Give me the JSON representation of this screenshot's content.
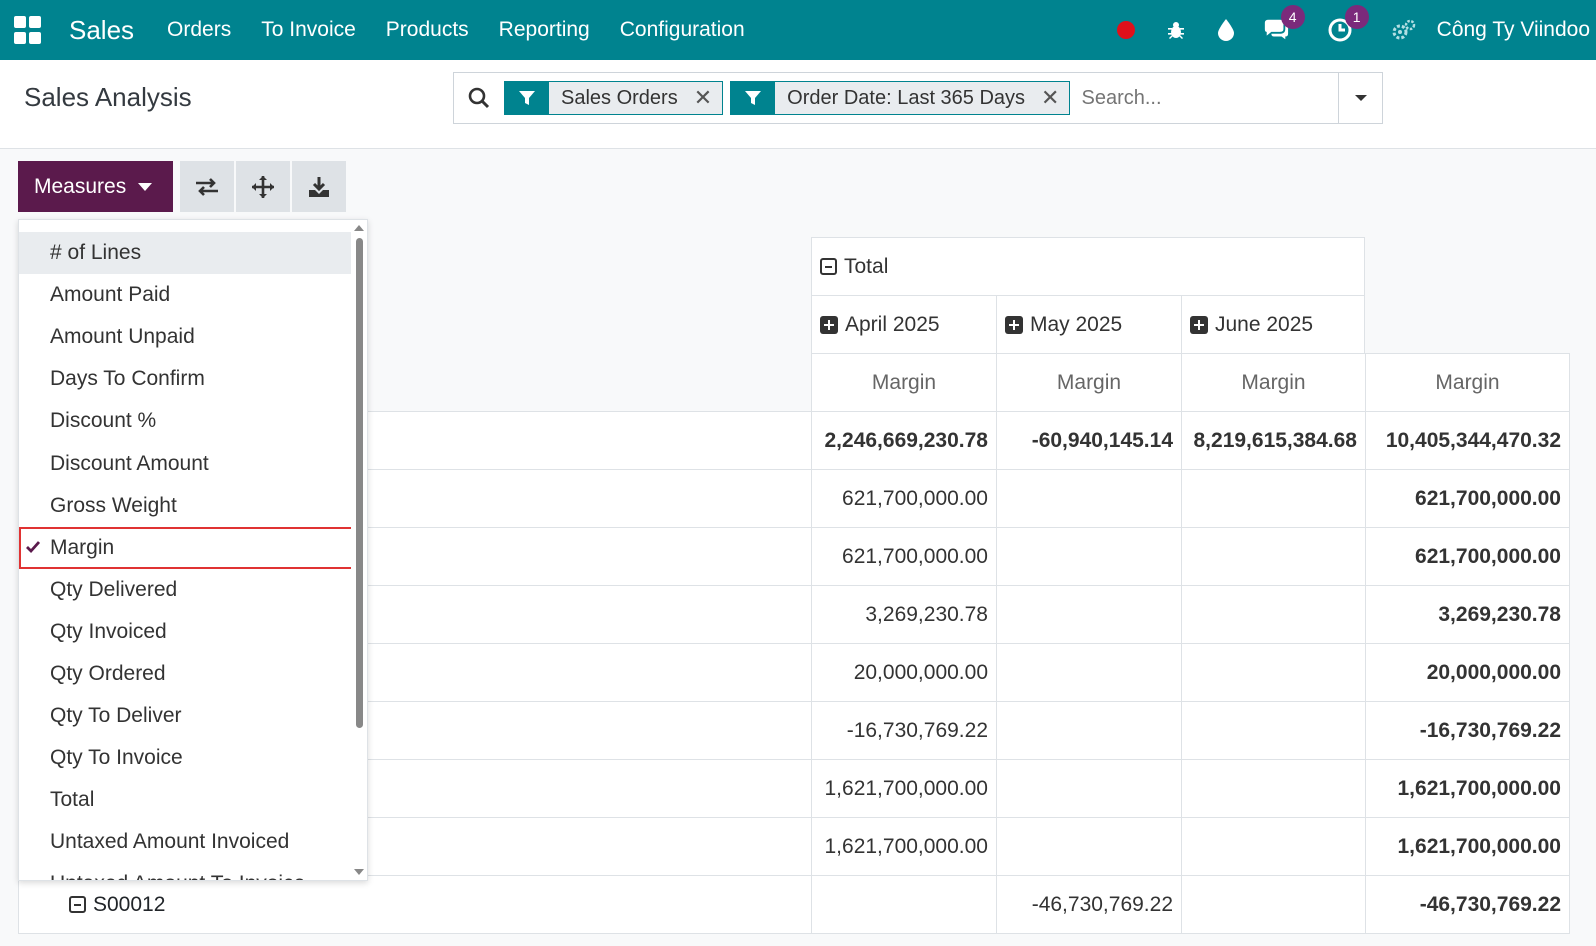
{
  "nav": {
    "app_name": "Sales",
    "menu": [
      "Orders",
      "To Invoice",
      "Products",
      "Reporting",
      "Configuration"
    ],
    "messages_count": "4",
    "activities_count": "1",
    "company": "Công Ty Viindoo"
  },
  "control": {
    "title": "Sales Analysis",
    "facets": [
      "Sales Orders",
      "Order Date: Last 365 Days"
    ],
    "search_placeholder": "Search..."
  },
  "toolbar": {
    "measures_label": "Measures"
  },
  "measures": {
    "items": [
      "# of Lines",
      "Amount Paid",
      "Amount Unpaid",
      "Days To Confirm",
      "Discount %",
      "Discount Amount",
      "Gross Weight",
      "Margin",
      "Qty Delivered",
      "Qty Invoiced",
      "Qty Ordered",
      "Qty To Deliver",
      "Qty To Invoice",
      "Total",
      "Untaxed Amount Invoiced",
      "Untaxed Amount To Invoice"
    ],
    "checked": "Margin"
  },
  "pivot": {
    "total_header": "Total",
    "columns": [
      "April 2025",
      "May 2025",
      "June 2025"
    ],
    "measure": "Margin",
    "totals_row": [
      "2,246,669,230.78",
      "-60,940,145.14",
      "8,219,615,384.68",
      "10,405,344,470.32"
    ],
    "rows": [
      {
        "label": "",
        "values": [
          "621,700,000.00",
          "",
          "",
          "621,700,000.00"
        ]
      },
      {
        "label": "",
        "values": [
          "621,700,000.00",
          "",
          "",
          "621,700,000.00"
        ]
      },
      {
        "label": "",
        "values": [
          "3,269,230.78",
          "",
          "",
          "3,269,230.78"
        ]
      },
      {
        "label": "",
        "values": [
          "20,000,000.00",
          "",
          "",
          "20,000,000.00"
        ]
      },
      {
        "label": "",
        "values": [
          "-16,730,769.22",
          "",
          "",
          "-16,730,769.22"
        ]
      },
      {
        "label": "",
        "values": [
          "1,621,700,000.00",
          "",
          "",
          "1,621,700,000.00"
        ]
      },
      {
        "label": "",
        "values": [
          "1,621,700,000.00",
          "",
          "",
          "1,621,700,000.00"
        ]
      },
      {
        "label": "S00012",
        "values": [
          "",
          "-46,730,769.22",
          "",
          "-46,730,769.22"
        ]
      }
    ]
  }
}
